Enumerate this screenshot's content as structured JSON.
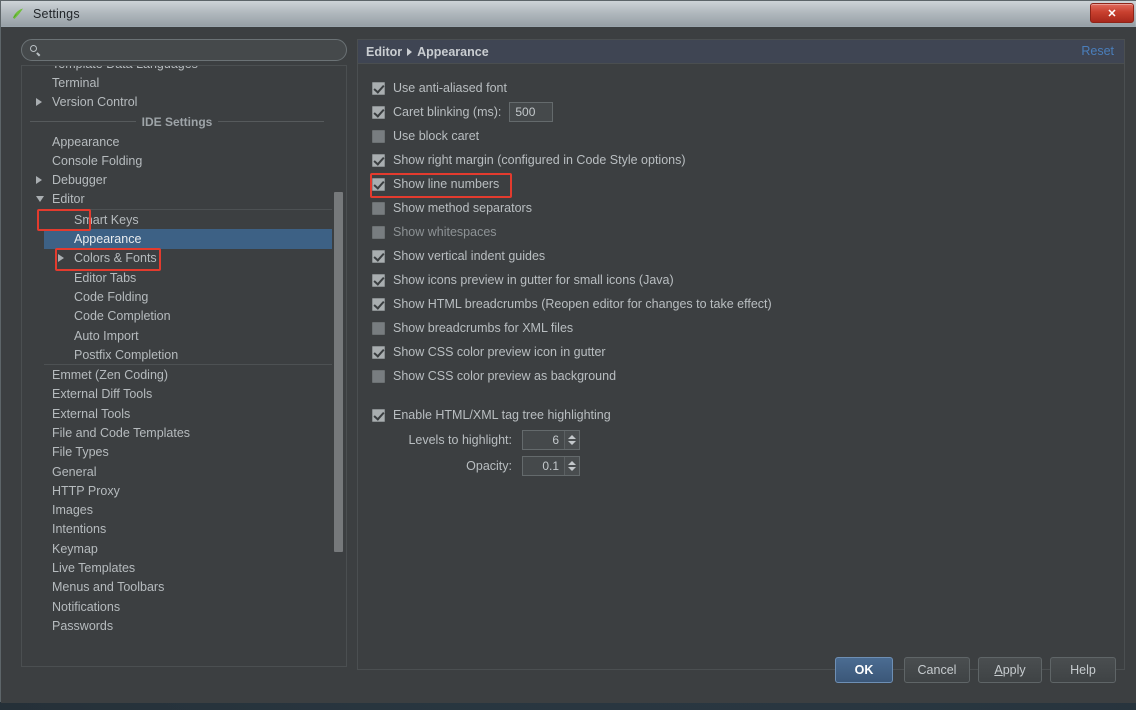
{
  "window": {
    "title": "Settings",
    "app_icon": "intellij-icon",
    "close_label": "✕"
  },
  "search": {
    "value": "",
    "placeholder": "",
    "icon": "search-icon"
  },
  "sidebar": {
    "section_separator": "IDE Settings",
    "items_top": [
      {
        "label": "Template Data Languages",
        "arrow": "none",
        "indent": 1
      },
      {
        "label": "Terminal",
        "arrow": "none",
        "indent": 1
      },
      {
        "label": "Version Control",
        "arrow": "right",
        "indent": 1
      }
    ],
    "items_ide": [
      {
        "label": "Appearance",
        "arrow": "none",
        "indent": 1
      },
      {
        "label": "Console Folding",
        "arrow": "none",
        "indent": 1
      },
      {
        "label": "Debugger",
        "arrow": "right",
        "indent": 1
      },
      {
        "label": "Editor",
        "arrow": "down",
        "indent": 1
      }
    ],
    "editor_children": [
      {
        "label": "Smart Keys",
        "arrow": "none"
      },
      {
        "label": "Appearance",
        "arrow": "none",
        "selected": true
      },
      {
        "label": "Colors & Fonts",
        "arrow": "right"
      },
      {
        "label": "Editor Tabs",
        "arrow": "none"
      },
      {
        "label": "Code Folding",
        "arrow": "none"
      },
      {
        "label": "Code Completion",
        "arrow": "none"
      },
      {
        "label": "Auto Import",
        "arrow": "none"
      },
      {
        "label": "Postfix Completion",
        "arrow": "none"
      }
    ],
    "items_rest": [
      {
        "label": "Emmet (Zen Coding)",
        "arrow": "none"
      },
      {
        "label": "External Diff Tools",
        "arrow": "none"
      },
      {
        "label": "External Tools",
        "arrow": "none"
      },
      {
        "label": "File and Code Templates",
        "arrow": "none"
      },
      {
        "label": "File Types",
        "arrow": "none"
      },
      {
        "label": "General",
        "arrow": "none"
      },
      {
        "label": "HTTP Proxy",
        "arrow": "none"
      },
      {
        "label": "Images",
        "arrow": "none"
      },
      {
        "label": "Intentions",
        "arrow": "none"
      },
      {
        "label": "Keymap",
        "arrow": "none"
      },
      {
        "label": "Live Templates",
        "arrow": "none"
      },
      {
        "label": "Menus and Toolbars",
        "arrow": "none"
      },
      {
        "label": "Notifications",
        "arrow": "none"
      },
      {
        "label": "Passwords",
        "arrow": "none"
      }
    ]
  },
  "content": {
    "breadcrumb": {
      "root": "Editor",
      "leaf": "Appearance"
    },
    "reset_label": "Reset",
    "options": [
      {
        "label": "Use anti-aliased font",
        "checked": true
      },
      {
        "label": "Caret blinking (ms):",
        "checked": true,
        "field_value": "500"
      },
      {
        "label": "Use block caret",
        "checked": false
      },
      {
        "label": "Show right margin (configured in Code Style options)",
        "checked": true
      },
      {
        "label": "Show line numbers",
        "checked": true,
        "highlighted": true
      },
      {
        "label": "Show method separators",
        "checked": false
      },
      {
        "label": "Show whitespaces",
        "checked": false,
        "disabled": true
      },
      {
        "label": "Show vertical indent guides",
        "checked": true
      },
      {
        "label": "Show icons preview in gutter for small icons (Java)",
        "checked": true
      },
      {
        "label": "Show HTML breadcrumbs (Reopen editor for changes to take effect)",
        "checked": true
      },
      {
        "label": "Show breadcrumbs for XML files",
        "checked": false
      },
      {
        "label": "Show CSS color preview icon in gutter",
        "checked": true
      },
      {
        "label": "Show CSS color preview as background",
        "checked": false
      }
    ],
    "tag_tree": {
      "enable_label": "Enable HTML/XML tag tree highlighting",
      "enable_checked": true,
      "levels_label": "Levels to highlight:",
      "levels_value": "6",
      "opacity_label": "Opacity:",
      "opacity_value": "0.1"
    }
  },
  "buttons": {
    "ok": "OK",
    "cancel": "Cancel",
    "apply_pre": "A",
    "apply_post": "pply",
    "help": "Help"
  },
  "colors": {
    "accent_selection": "#3d6185",
    "annotation_red": "#e33b2e",
    "link_blue": "#4a7ebb",
    "window_bg": "#3c3f41"
  }
}
